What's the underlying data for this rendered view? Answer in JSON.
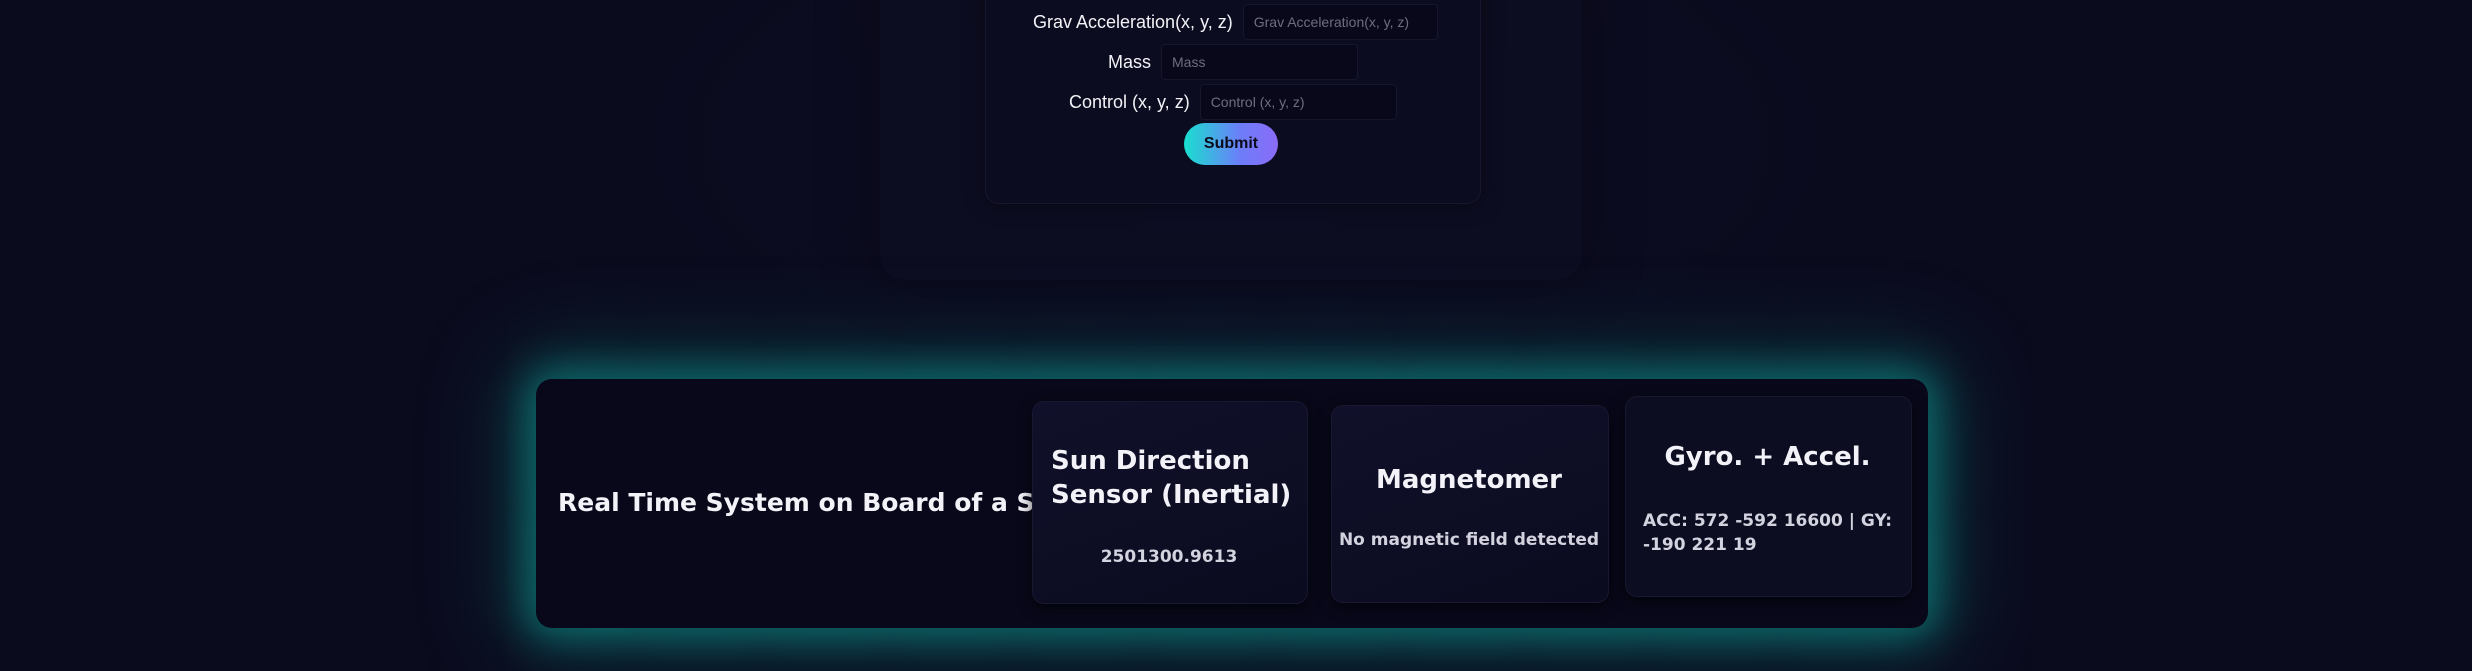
{
  "form": {
    "grav": {
      "label": "Grav Acceleration(x, y, z)",
      "placeholder": "Grav Acceleration(x, y, z)",
      "value": ""
    },
    "mass": {
      "label": "Mass",
      "placeholder": "Mass",
      "value": ""
    },
    "control": {
      "label": "Control (x, y, z)",
      "placeholder": "Control (x, y, z)",
      "value": ""
    },
    "submit_label": "Submit"
  },
  "panel": {
    "title": "Real Time System on Board of a S/C",
    "accent_color": "#10bead",
    "sun": {
      "heading": "Sun Direction Sensor (Inertial)",
      "value": "2501300.9613"
    },
    "magnetometer": {
      "heading": "Magnetomer",
      "value": "No magnetic field detected"
    },
    "gyro": {
      "heading": "Gyro. + Accel.",
      "value": "ACC: 572 -592 16600 | GY: -190 221 19"
    }
  }
}
